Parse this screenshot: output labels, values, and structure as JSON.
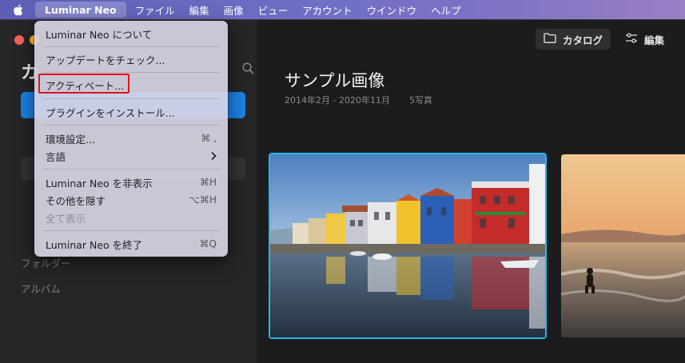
{
  "menubar": {
    "app_name": "Luminar Neo",
    "items": [
      "ファイル",
      "編集",
      "画像",
      "ビュー",
      "アカウント",
      "ウインドウ",
      "ヘルプ"
    ]
  },
  "app_menu": {
    "about": "Luminar Neo について",
    "check_updates": "アップデートをチェック...",
    "activate": "アクティベート...",
    "install_plugins": "プラグインをインストール...",
    "preferences": "環境設定...",
    "preferences_shortcut": "⌘ ,",
    "language": "言語",
    "hide_app": "Luminar Neo を非表示",
    "hide_app_shortcut": "⌘H",
    "hide_others": "その他を隠す",
    "hide_others_shortcut": "⌥⌘H",
    "show_all": "全て表示",
    "quit": "Luminar Neo を終了",
    "quit_shortcut": "⌘Q"
  },
  "sidebar": {
    "title_partial": "カ",
    "folders": "フォルダー",
    "albums": "アルバム"
  },
  "toolbar": {
    "catalog": "カタログ",
    "edit": "編集"
  },
  "gallery": {
    "title": "サンプル画像",
    "date_range": "2014年2月 - 2020年11月",
    "count": "5写真"
  },
  "colors": {
    "selection_border": "#27b6e8",
    "highlight_box": "#e0141c",
    "primary_button": "#1a82e6"
  }
}
